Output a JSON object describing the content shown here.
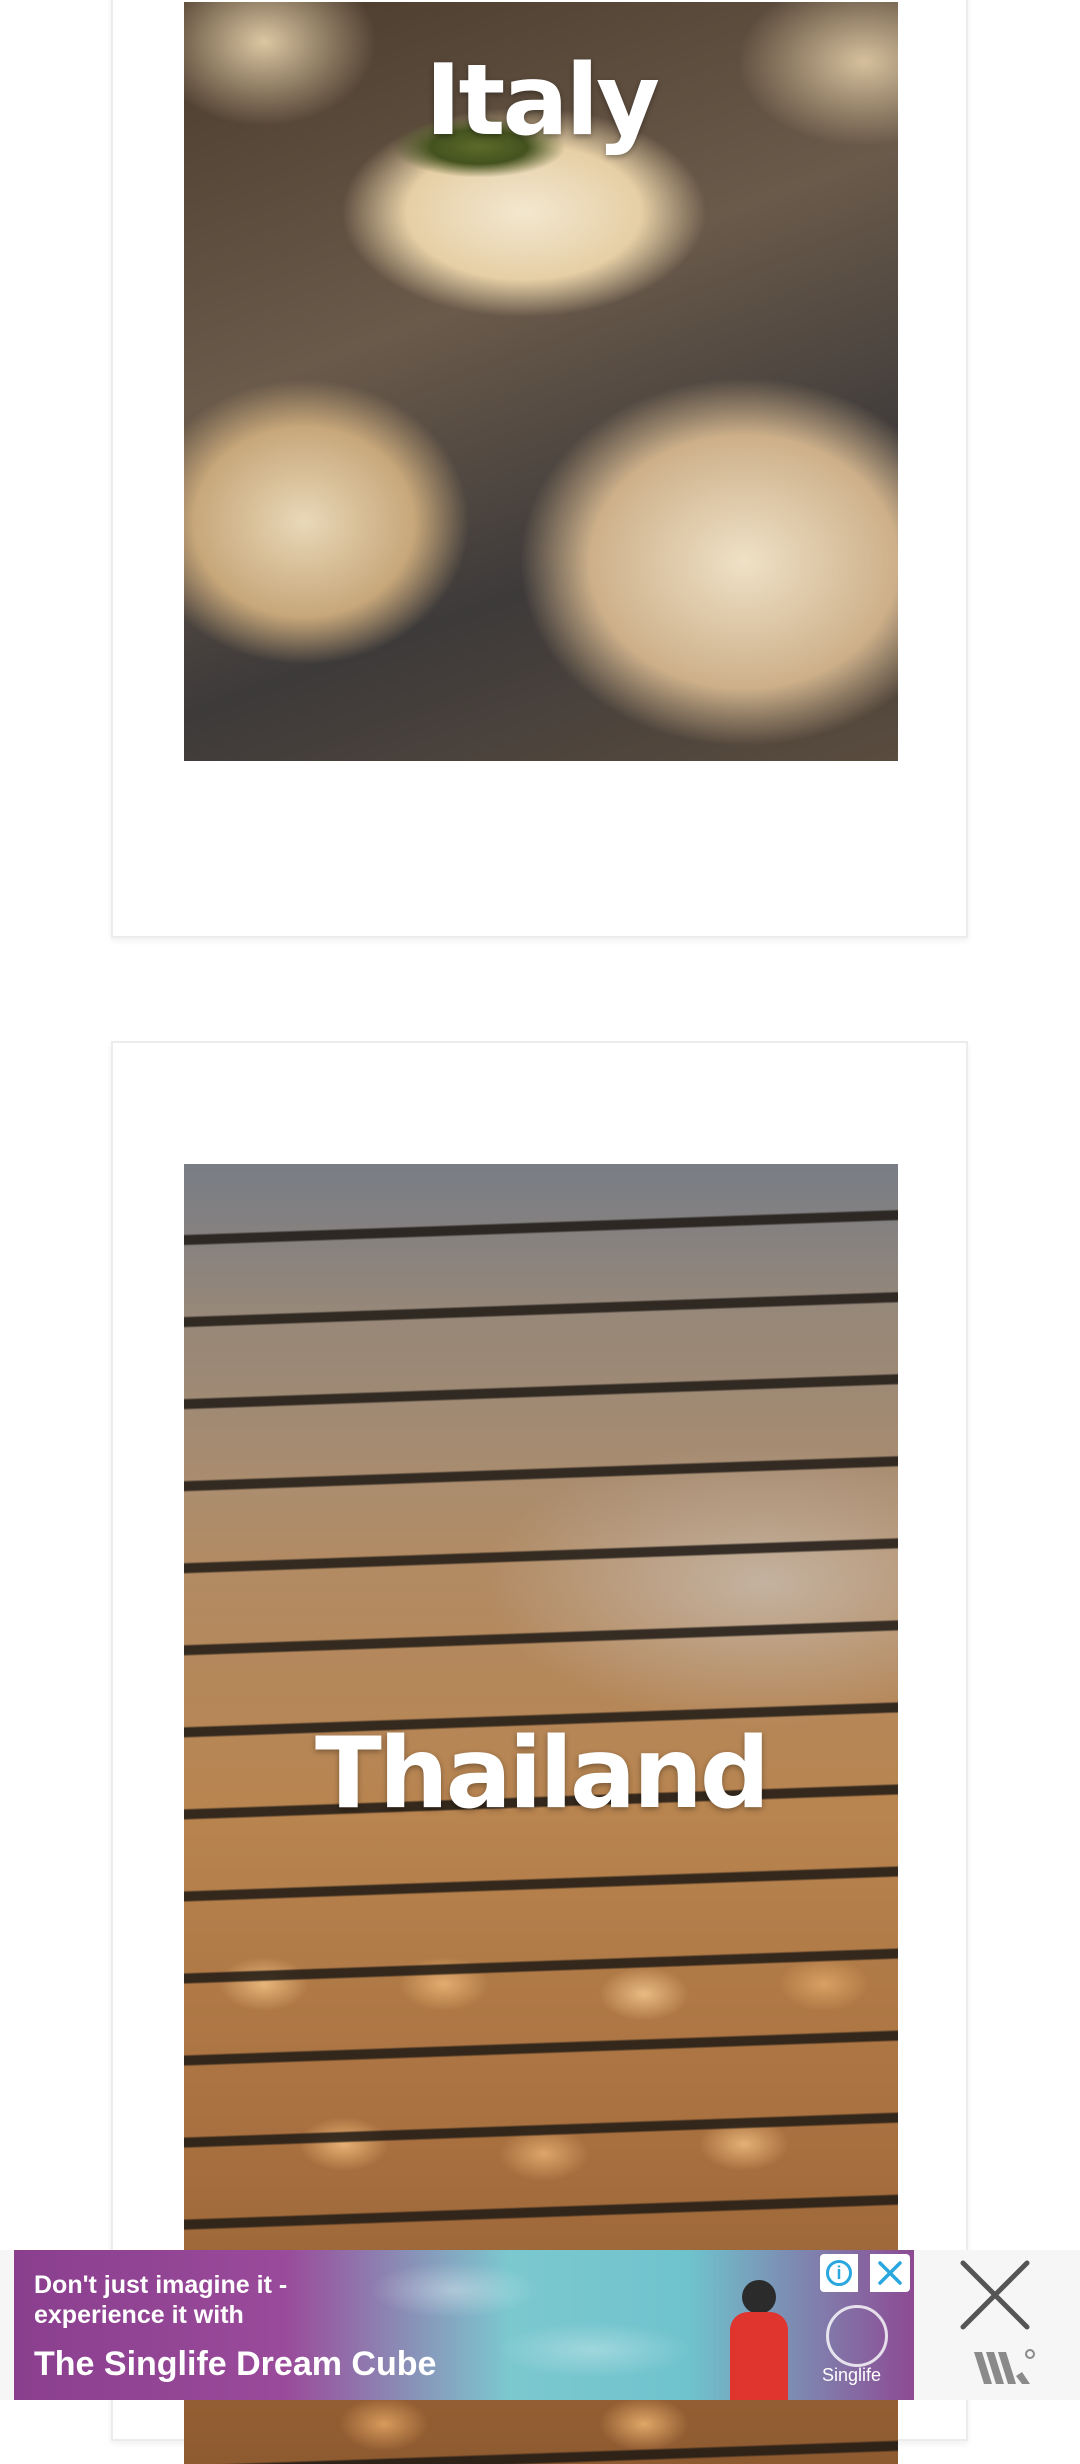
{
  "cards": [
    {
      "title": "Italy",
      "image": "dumplings-photo"
    },
    {
      "title": "Thailand",
      "image": "grilled-chicken-photo"
    }
  ],
  "ad": {
    "headline": "Don't just imagine it - experience it with",
    "product": "The Singlife Dream Cube",
    "brand": "Singlife",
    "info_icon": "info-icon",
    "close_icon": "close-icon",
    "network_icon": "ad-network-icon",
    "colors": {
      "purple": "#8a3f8e",
      "teal": "#6fc3cd",
      "info_blue": "#2aa7de"
    }
  }
}
